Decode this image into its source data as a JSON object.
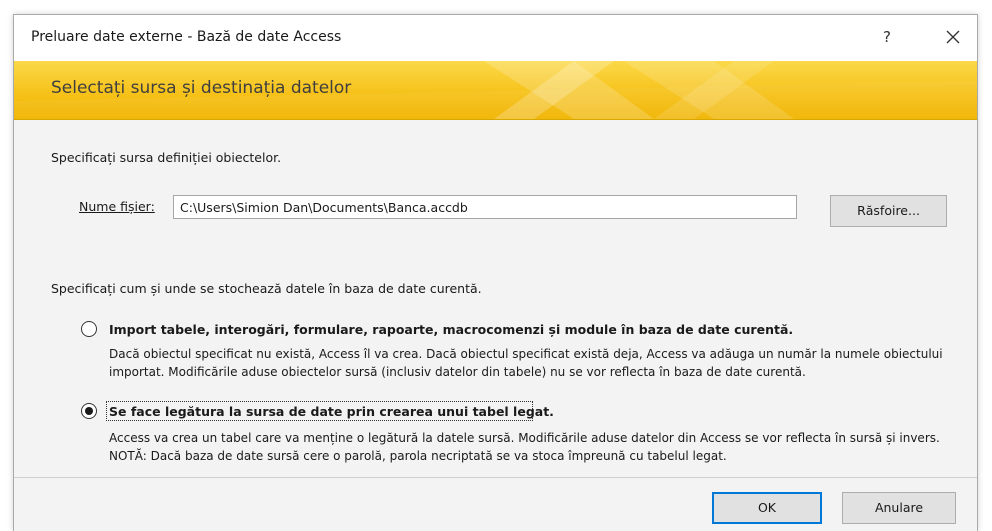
{
  "window": {
    "title": "Preluare date externe - Bază de date Access",
    "help_label": "?"
  },
  "banner": {
    "heading": "Selectați sursa și destinația datelor"
  },
  "source": {
    "instruction": "Specificați sursa definiției obiectelor.",
    "file_label": "Nume fișier:",
    "file_value": "C:\\Users\\Simion Dan\\Documents\\Banca.accdb",
    "browse_label": "Răsfoire..."
  },
  "storage": {
    "instruction": "Specificați cum și unde se stochează datele în baza de date curentă.",
    "options": [
      {
        "title": "Import tabele, interogări, formulare, rapoarte, macrocomenzi și module în baza de date curentă.",
        "description": "Dacă obiectul specificat nu există, Access îl va crea. Dacă obiectul specificat există deja, Access va adăuga un număr la numele obiectului importat. Modificările aduse obiectelor sursă (inclusiv datelor din tabele) nu se vor reflecta în baza de date curentă.",
        "selected": false
      },
      {
        "title": "Se face legătura la sursa de date prin crearea unui tabel legat.",
        "description": "Access va crea un tabel care va menține o legătură la datele sursă. Modificările aduse datelor din Access se vor reflecta în sursă și invers. NOTĂ: Dacă baza de date sursă cere o parolă, parola necriptată se va stoca împreună cu tabelul legat.",
        "selected": true
      }
    ]
  },
  "footer": {
    "ok_label": "OK",
    "cancel_label": "Anulare"
  },
  "colors": {
    "banner_accent": "#f6c21a",
    "default_button_border": "#0078d7"
  }
}
